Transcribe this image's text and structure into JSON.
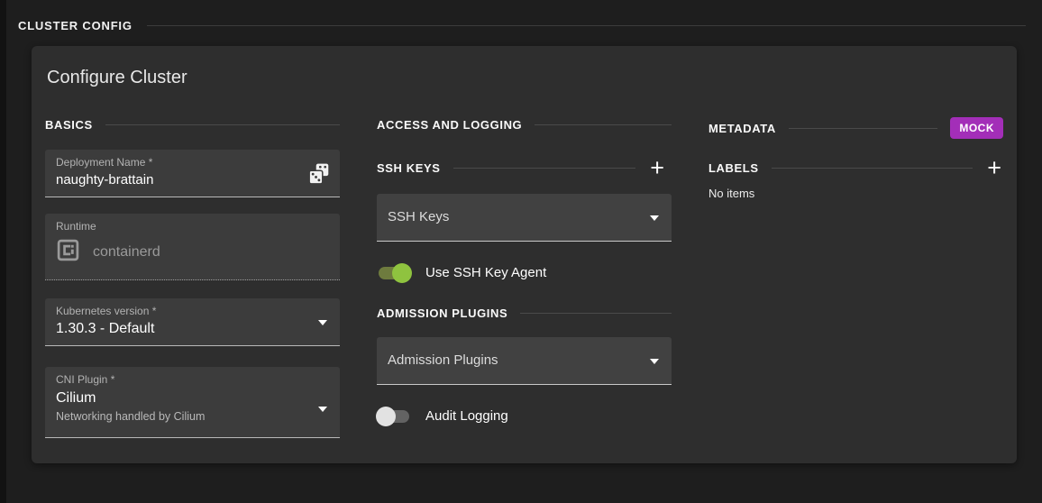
{
  "header": {
    "title": "CLUSTER CONFIG"
  },
  "card": {
    "title": "Configure Cluster"
  },
  "basics": {
    "section": "BASICS",
    "deployment_name": {
      "label": "Deployment Name *",
      "value": "naughty-brattain"
    },
    "runtime": {
      "label": "Runtime",
      "value": "containerd"
    },
    "kubernetes_version": {
      "label": "Kubernetes version *",
      "value": "1.30.3 - Default"
    },
    "cni_plugin": {
      "label": "CNI Plugin *",
      "value": "Cilium",
      "description": "Networking handled by Cilium"
    }
  },
  "access": {
    "section": "ACCESS AND LOGGING",
    "ssh_keys_header": "SSH KEYS",
    "ssh_keys_select": {
      "value": "SSH Keys"
    },
    "ssh_agent": {
      "label": "Use SSH Key Agent",
      "state": "on"
    },
    "admission_header": "ADMISSION PLUGINS",
    "admission_select": {
      "value": "Admission Plugins"
    },
    "audit_logging": {
      "label": "Audit Logging",
      "state": "off"
    }
  },
  "metadata": {
    "section": "METADATA",
    "badge": "MOCK",
    "labels_header": "LABELS",
    "labels_empty": "No items"
  },
  "icons": {
    "plus": "+"
  },
  "colors": {
    "page_bg": "#1e1e1e",
    "card_bg": "#2e2e2e",
    "field_bg": "#3c3c3c",
    "toggle_on_knob": "#8fc33f",
    "toggle_on_track": "#6e7b3e",
    "badge_bg": "#a32eb8"
  }
}
